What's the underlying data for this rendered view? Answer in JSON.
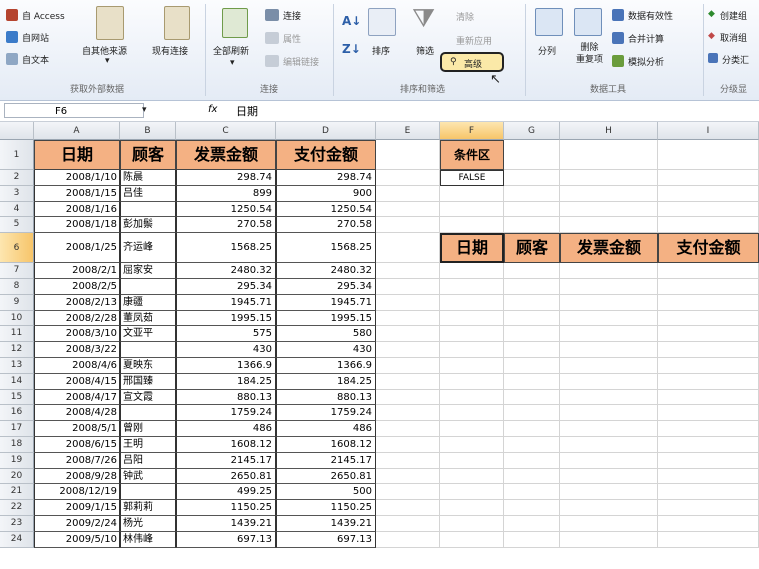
{
  "ribbon": {
    "external": {
      "from_access": "自 Access",
      "from_web": "自网站",
      "from_text": "自文本",
      "other_sources": "自其他来源",
      "existing_conn": "现有连接",
      "group": "获取外部数据"
    },
    "connections": {
      "refresh_all": "全部刷新",
      "connections": "连接",
      "properties": "属性",
      "edit_links": "编辑链接",
      "group": "连接"
    },
    "sort_filter": {
      "sort": "排序",
      "filter": "筛选",
      "clear": "清除",
      "reapply": "重新应用",
      "advanced": "高级",
      "group": "排序和筛选"
    },
    "data_tools": {
      "text_to_columns": "分列",
      "remove_dup": "删除\n重复项",
      "validation": "数据有效性",
      "consolidate": "合并计算",
      "whatif": "模拟分析",
      "group": "数据工具"
    },
    "outline": {
      "group_btn": "创建组",
      "ungroup": "取消组",
      "subtotal": "分类汇",
      "group": "分级显"
    }
  },
  "formula_bar": {
    "name_box": "F6",
    "fx": "fx",
    "value": "日期"
  },
  "columns": [
    "A",
    "B",
    "C",
    "D",
    "E",
    "F",
    "G",
    "H",
    "I"
  ],
  "headers": [
    "日期",
    "顾客",
    "发票金额",
    "支付金额"
  ],
  "rows": [
    [
      "2008/1/10",
      "陈晨",
      "298.74",
      "298.74"
    ],
    [
      "2008/1/15",
      "吕佳",
      "899",
      "900"
    ],
    [
      "2008/1/16",
      "",
      "1250.54",
      "1250.54"
    ],
    [
      "2008/1/18",
      "彭加鬃",
      "270.58",
      "270.58"
    ],
    [
      "2008/1/25",
      "齐运峰",
      "1568.25",
      "1568.25"
    ],
    [
      "2008/2/1",
      "屈家安",
      "2480.32",
      "2480.32"
    ],
    [
      "2008/2/5",
      "",
      "295.34",
      "295.34"
    ],
    [
      "2008/2/13",
      "康疆",
      "1945.71",
      "1945.71"
    ],
    [
      "2008/2/28",
      "董凤茹",
      "1995.15",
      "1995.15"
    ],
    [
      "2008/3/10",
      "文亚平",
      "575",
      "580"
    ],
    [
      "2008/3/22",
      "",
      "430",
      "430"
    ],
    [
      "2008/4/6",
      "夏映东",
      "1366.9",
      "1366.9"
    ],
    [
      "2008/4/15",
      "邢国臻",
      "184.25",
      "184.25"
    ],
    [
      "2008/4/17",
      "宣文霞",
      "880.13",
      "880.13"
    ],
    [
      "2008/4/28",
      "",
      "1759.24",
      "1759.24"
    ],
    [
      "2008/5/1",
      "曾刚",
      "486",
      "486"
    ],
    [
      "2008/6/15",
      "王明",
      "1608.12",
      "1608.12"
    ],
    [
      "2008/7/26",
      "吕阳",
      "2145.17",
      "2145.17"
    ],
    [
      "2008/9/28",
      "钟武",
      "2650.81",
      "2650.81"
    ],
    [
      "2008/12/19",
      "",
      "499.25",
      "500"
    ],
    [
      "2009/1/15",
      "郭莉莉",
      "1150.25",
      "1150.25"
    ],
    [
      "2009/2/24",
      "杨光",
      "1439.21",
      "1439.21"
    ],
    [
      "2009/5/10",
      "林伟峰",
      "697.13",
      "697.13"
    ]
  ],
  "criteria": {
    "title": "条件区",
    "value": "FALSE"
  },
  "output_headers": [
    "日期",
    "顾客",
    "发票金额",
    "支付金额"
  ],
  "colors": {
    "header_fill": "#f4b183",
    "output_fill": "#f4b183",
    "selected_cell": "#f9d1a9"
  }
}
